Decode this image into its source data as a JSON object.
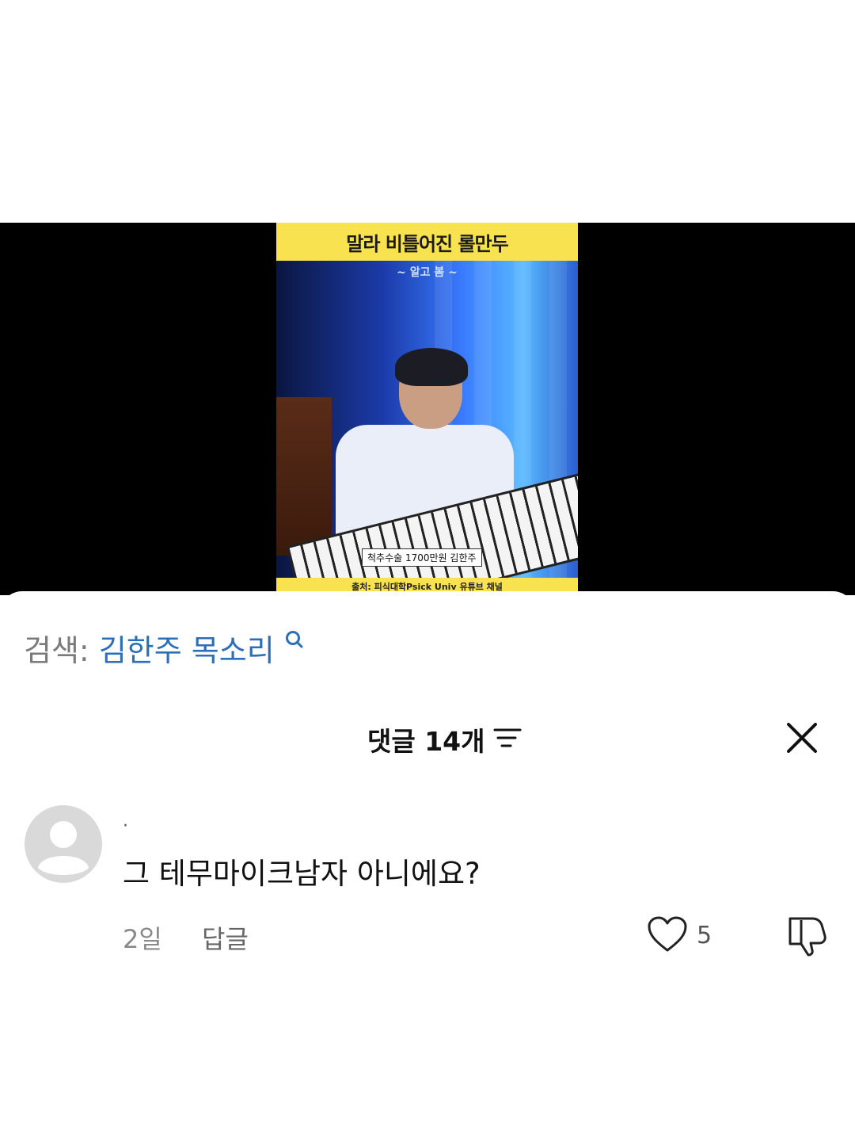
{
  "video": {
    "title": "말라 비틀어진 롤만두",
    "subtag": "~ 알고 봄 ~",
    "caption": "척추수술 1700만원 김한주",
    "source": "출처: 피식대학Psick Univ 유튜브 채널"
  },
  "search": {
    "label": "검색:",
    "query": "김한주 목소리"
  },
  "comments": {
    "title": "댓글 14개"
  },
  "comment": {
    "author": "·",
    "text": "그 테무마이크남자 아니에요?",
    "time": "2일",
    "reply_label": "답글",
    "likes": "5"
  },
  "icons": {
    "search": "search-icon",
    "sort": "sort-icon",
    "close": "close-icon",
    "avatar": "default-avatar-icon",
    "like": "heart-icon",
    "dislike": "thumbs-down-icon"
  },
  "colors": {
    "search_query": "#2d6fb7",
    "thumb_banner": "#f8e24f"
  }
}
